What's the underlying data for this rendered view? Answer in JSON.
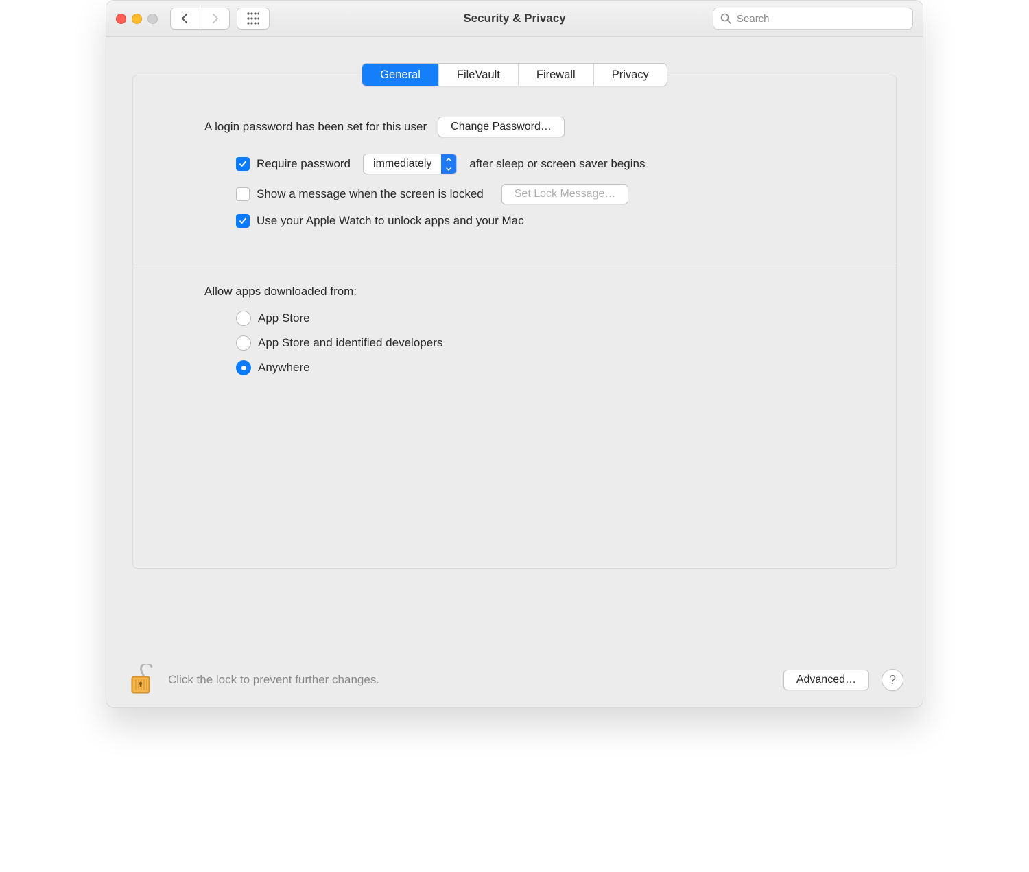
{
  "title": "Security & Privacy",
  "search": {
    "placeholder": "Search"
  },
  "tabs": {
    "general": "General",
    "filevault": "FileVault",
    "firewall": "Firewall",
    "privacy": "Privacy"
  },
  "login": {
    "intro": "A login password has been set for this user",
    "change_btn": "Change Password…"
  },
  "options": {
    "require_password_label": "Require password",
    "require_password_after": "after sleep or screen saver begins",
    "delay_selected": "immediately",
    "show_message_label": "Show a message when the screen is locked",
    "set_lock_message_btn": "Set Lock Message…",
    "apple_watch_label": "Use your Apple Watch to unlock apps and your Mac"
  },
  "allow": {
    "label": "Allow apps downloaded from:",
    "app_store": "App Store",
    "app_store_identified": "App Store and identified developers",
    "anywhere": "Anywhere"
  },
  "footer": {
    "lock_text": "Click the lock to prevent further changes.",
    "advanced_btn": "Advanced…",
    "help": "?"
  }
}
